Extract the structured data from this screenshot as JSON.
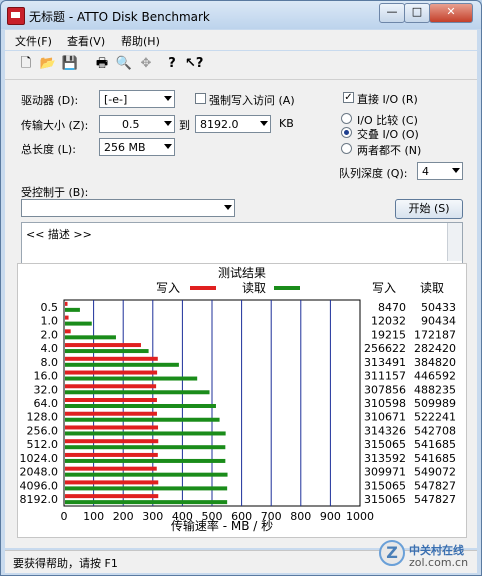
{
  "window": {
    "title": "无标题 - ATTO Disk Benchmark",
    "min": "—",
    "max": "□",
    "close": "✕"
  },
  "menu": [
    "文件(F)",
    "查看(V)",
    "帮助(H)"
  ],
  "toolbar_icons": [
    "new-file-icon",
    "open-folder-icon",
    "save-icon",
    "print-icon",
    "print-preview-icon",
    "move-icon",
    "help-icon",
    "context-help-icon"
  ],
  "form": {
    "drive_label": "驱动器 (D):",
    "drive_value": "[-e-]",
    "force_write_label": "强制写入访问 (A)",
    "transfer_label": "传输大小 (Z):",
    "transfer_from": "0.5",
    "to_label": "到",
    "transfer_to": "8192.0",
    "kb_label": "KB",
    "total_length_label": "总长度 (L):",
    "total_length_value": "256 MB",
    "direct_io_label": "直接 I/O (R)",
    "io_compare_label": "I/O 比较 (C)",
    "overlap_io_label": "交叠 I/O (O)",
    "neither_label": "两者都不 (N)",
    "queue_depth_label": "队列深度 (Q):",
    "queue_depth_value": "4",
    "controlled_by_label": "受控制于 (B):",
    "controlled_by_value": "",
    "start_button": "开始 (S)",
    "description": "<< 描述 >>"
  },
  "chart_data": {
    "type": "bar",
    "title": "测试结果",
    "legend": {
      "write": "写入",
      "read": "读取",
      "placement": "top-center"
    },
    "col_headers": {
      "write": "写入",
      "read": "读取"
    },
    "categories": [
      "0.5",
      "1.0",
      "2.0",
      "4.0",
      "8.0",
      "16.0",
      "32.0",
      "64.0",
      "128.0",
      "256.0",
      "512.0",
      "1024.0",
      "2048.0",
      "4096.0",
      "8192.0"
    ],
    "series": [
      {
        "name": "写入",
        "color": "#e02020",
        "values": [
          8470,
          12032,
          19215,
          256622,
          313491,
          311157,
          307856,
          310598,
          310671,
          314326,
          315065,
          313592,
          309971,
          315065,
          315065
        ]
      },
      {
        "name": "读取",
        "color": "#1a8c1a",
        "values": [
          50433,
          90434,
          172187,
          282420,
          384820,
          446592,
          488235,
          509989,
          522241,
          542708,
          541685,
          541685,
          549072,
          547827,
          547827
        ]
      }
    ],
    "write_display": [
      "8470",
      "12032",
      "19215",
      "256622",
      "313491",
      "311157",
      "307856",
      "310598",
      "310671",
      "314326",
      "315065",
      "313592",
      "309971",
      "315065",
      "315065"
    ],
    "read_display": [
      "50433",
      "90434",
      "172187",
      "282420",
      "384820",
      "446592",
      "488235",
      "509989",
      "522241",
      "542708",
      "541685",
      "541685",
      "549072",
      "547827",
      "547827"
    ],
    "x_ticks": [
      "0",
      "100",
      "200",
      "300",
      "400",
      "500",
      "600",
      "700",
      "800",
      "900",
      "1000"
    ],
    "xlim": [
      0,
      1000
    ],
    "x_unit_divisor": 1000,
    "xlabel": "传输速率 - MB / 秒",
    "grid": true
  },
  "status": {
    "text": "要获得帮助，请按 F1"
  },
  "watermark": {
    "line1": "中关村在线",
    "line2": "zol.com.cn"
  }
}
